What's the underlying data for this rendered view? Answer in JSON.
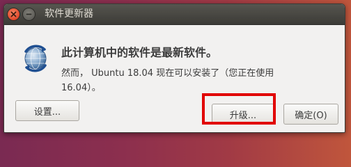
{
  "window": {
    "title": "软件更新器",
    "controls": {
      "close_icon": "close-icon",
      "minimize_icon": "minimize-icon"
    }
  },
  "dialog": {
    "icon": "software-updater-icon",
    "heading": "此计算机中的软件是最新软件。",
    "message": "然而， Ubuntu 18.04 现在可以安装了（您正在使用 16.04）。"
  },
  "buttons": {
    "settings_label": "设置...",
    "upgrade_label": "升级...",
    "ok_label": "确定(O)"
  },
  "colors": {
    "titlebar": "#3c3b37",
    "dialog_background": "#f2f1f0",
    "close_button": "#e1462a",
    "highlight": "#e10000",
    "desktop_background": "#8c2f4e"
  }
}
